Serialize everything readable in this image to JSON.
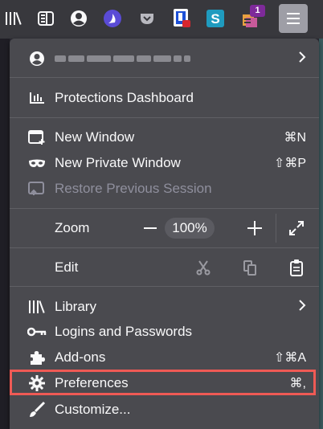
{
  "toolbar": {
    "icons": [
      "library-icon",
      "sidebar-icon",
      "account-icon",
      "extension-icon",
      "pocket-icon",
      "extension-icon",
      "extension-icon",
      "extension-icon"
    ],
    "badge_count": "1"
  },
  "menu": {
    "protections_dashboard": "Protections Dashboard",
    "new_window": "New Window",
    "new_window_shortcut": "⌘N",
    "new_private_window": "New Private Window",
    "new_private_window_shortcut": "⇧⌘P",
    "restore_previous_session": "Restore Previous Session",
    "zoom_label": "Zoom",
    "zoom_value": "100%",
    "zoom_minus": "−",
    "zoom_plus": "+",
    "edit_label": "Edit",
    "library": "Library",
    "logins_and_passwords": "Logins and Passwords",
    "addons": "Add-ons",
    "addons_shortcut": "⇧⌘A",
    "preferences": "Preferences",
    "preferences_shortcut": "⌘,",
    "customize": "Customize..."
  },
  "colors": {
    "highlight": "#ef5a55",
    "panel": "#4a4a4f",
    "menu_button": "#9e9ea6"
  }
}
